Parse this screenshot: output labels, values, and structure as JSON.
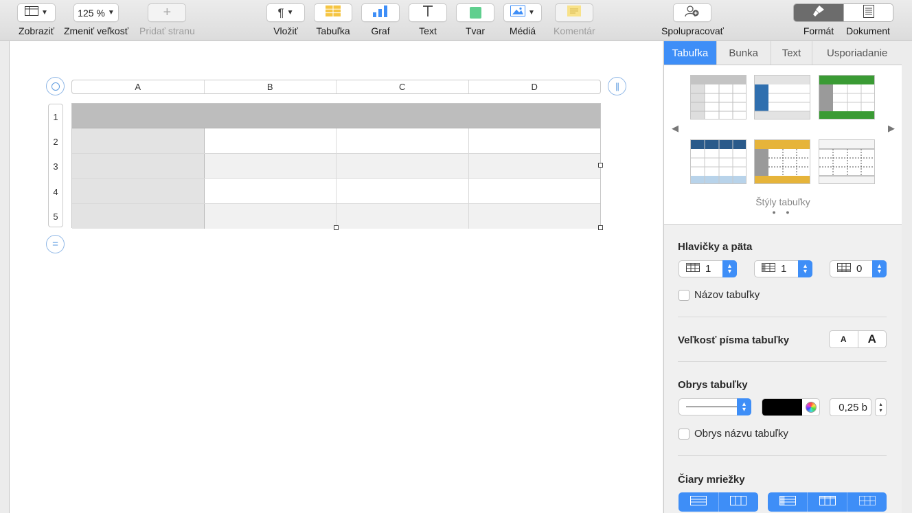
{
  "toolbar": {
    "view_label": "Zobraziť",
    "zoom_label": "Zmeniť veľkosť",
    "zoom_value": "125 %",
    "addpage_label": "Pridať stranu",
    "insert_label": "Vložiť",
    "table_label": "Tabuľka",
    "chart_label": "Graf",
    "text_label": "Text",
    "shape_label": "Tvar",
    "media_label": "Médiá",
    "comment_label": "Komentár",
    "collaborate_label": "Spolupracovať",
    "format_label": "Formát",
    "document_label": "Dokument"
  },
  "table": {
    "columns": [
      "A",
      "B",
      "C",
      "D"
    ],
    "rows": [
      "1",
      "2",
      "3",
      "4",
      "5"
    ]
  },
  "inspector": {
    "tabs": [
      "Tabuľka",
      "Bunka",
      "Text",
      "Usporiadanie"
    ],
    "active_tab": "Tabuľka",
    "styles_caption": "Štýly tabuľky",
    "headers_footer_title": "Hlavičky a päta",
    "header_rows_value": "1",
    "header_cols_value": "1",
    "footer_rows_value": "0",
    "table_name_label": "Názov tabuľky",
    "font_size_title": "Veľkosť písma tabuľky",
    "font_small": "A",
    "font_large": "A",
    "outline_title": "Obrys tabuľky",
    "outline_width": "0,25 b",
    "outline_color": "#000000",
    "outline_name_label": "Obrys názvu tabuľky",
    "gridlines_title": "Čiary mriežky"
  },
  "colors": {
    "accent": "#3e8ef7",
    "header_row": "#bdbdbd",
    "style_blue": "#2f6faf",
    "style_green": "#3a9b34",
    "style_yellow": "#e6b43a"
  }
}
